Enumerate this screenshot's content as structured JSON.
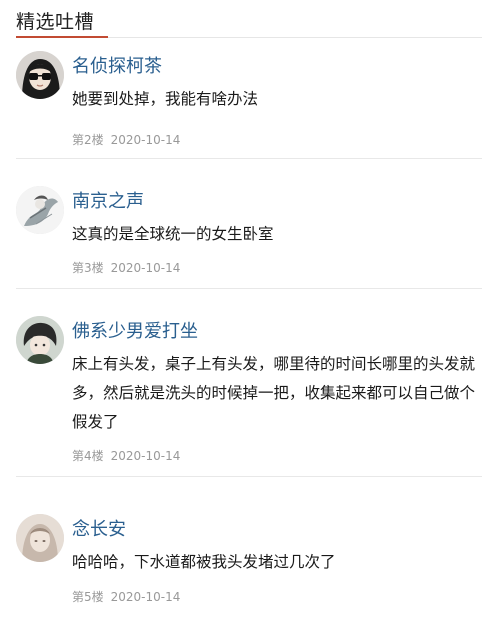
{
  "section": {
    "title": "精选吐槽",
    "accent_color": "#c24b33"
  },
  "comments": [
    {
      "username": "名侦探柯茶",
      "text": "她要到处掉，我能有啥办法",
      "floor": "第2楼",
      "date": "2020-10-14",
      "avatar_icon": "avatar-sunglasses-girl-icon"
    },
    {
      "username": "南京之声",
      "text": "这真的是全球统一的女生卧室",
      "floor": "第3楼",
      "date": "2020-10-14",
      "avatar_icon": "avatar-ink-illustration-icon"
    },
    {
      "username": "佛系少男爱打坐",
      "text": "床上有头发，桌子上有头发，哪里待的时间长哪里的头发就多，然后就是洗头的时候掉一把，收集起来都可以自己做个假发了",
      "floor": "第4楼",
      "date": "2020-10-14",
      "avatar_icon": "avatar-anime-boy-icon"
    },
    {
      "username": "念长安",
      "text": "哈哈哈，下水道都被我头发堵过几次了",
      "floor": "第5楼",
      "date": "2020-10-14",
      "avatar_icon": "avatar-blurry-portrait-icon"
    }
  ]
}
